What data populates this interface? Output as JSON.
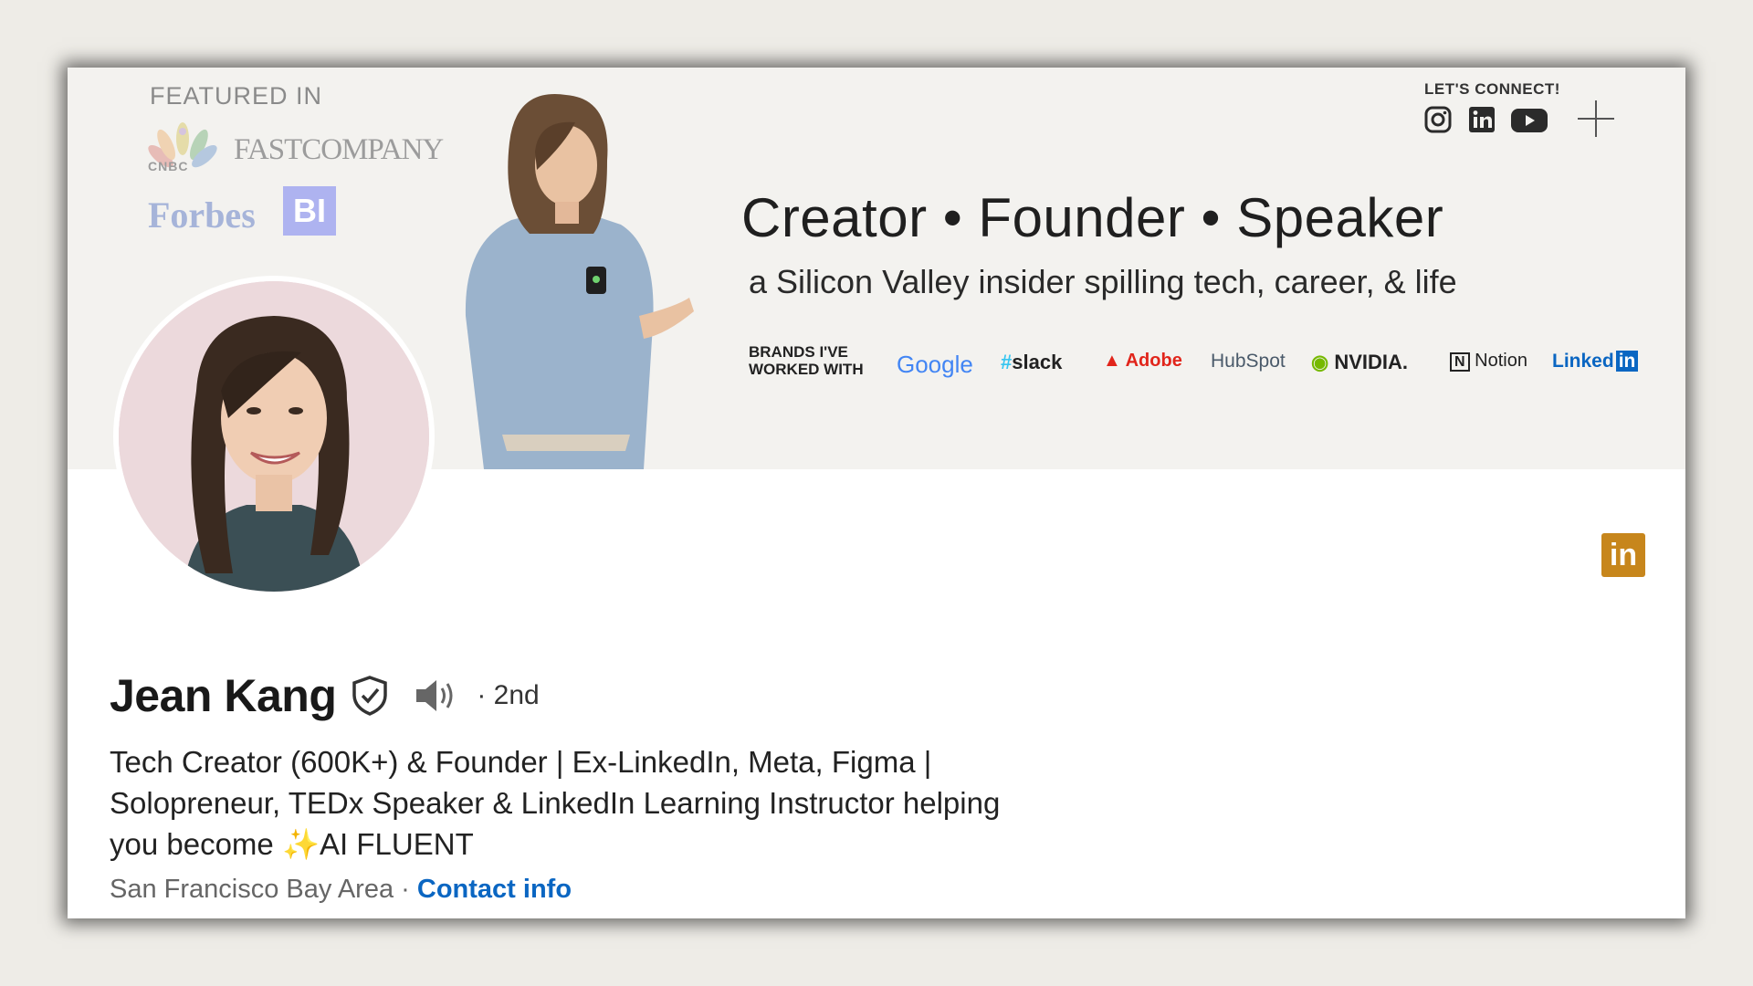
{
  "banner": {
    "featured_label": "FEATURED IN",
    "featured_logos": {
      "cnbc": "CNBC",
      "fastcompany": "FASTCOMPANY",
      "forbes": "Forbes",
      "bi": "BI"
    },
    "connect_label": "LET'S CONNECT!",
    "social_icons": [
      "instagram-icon",
      "linkedin-icon",
      "youtube-icon"
    ],
    "tagline": "Creator • Founder • Speaker",
    "subtagline": "a Silicon Valley insider spilling tech, career, & life",
    "brands_label_line1": "BRANDS I'VE",
    "brands_label_line2": "WORKED WITH",
    "brands": {
      "google": "Google",
      "slack": "slack",
      "adobe": "Adobe",
      "hubspot": "HubSpot",
      "nvidia": "NVIDIA.",
      "notion": "Notion",
      "linkedin": "Linked",
      "linkedin_in": "in"
    }
  },
  "profile": {
    "name": "Jean Kang",
    "degree": "· 2nd",
    "headline_line1": "Tech Creator (600K+) & Founder | Ex-LinkedIn, Meta, Figma |",
    "headline_line2": "Solopreneur, TEDx Speaker & LinkedIn Learning Instructor helping",
    "headline_line3_prefix": "you become ",
    "headline_sparkle": "✨",
    "headline_line3_suffix": "AI FLUENT",
    "location": "San Francisco Bay Area",
    "separator": " · ",
    "contact_link": "Contact info",
    "linkedin_badge": "in"
  },
  "colors": {
    "link_blue": "#0a66c2",
    "badge_gold": "#c7861c",
    "banner_bg": "#f3f2ef",
    "avatar_bg": "#ecd9dc"
  }
}
